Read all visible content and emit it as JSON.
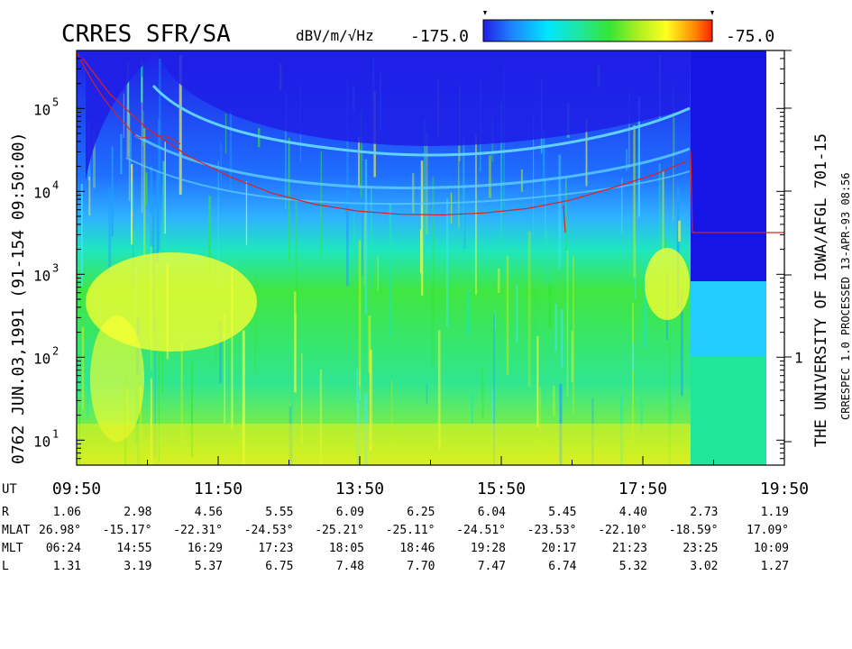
{
  "chart_data": {
    "type": "heatmap",
    "title": "CRRES SFR/SA",
    "colorbar": {
      "label": "dBV/m/√Hz",
      "min": -175.0,
      "max": -75.0,
      "min_label": "-175.0",
      "max_label": "-75.0",
      "colors": [
        "#1f1fe6",
        "#1f7fff",
        "#00e6ff",
        "#1fe6a0",
        "#33e633",
        "#b0f020",
        "#ffff20",
        "#ff8c00",
        "#ff2000"
      ]
    },
    "left_label": "0762   JUN.03,1991   (91-154 09:50:00)",
    "y_axis": {
      "scale": "log",
      "range": [
        5,
        500000
      ],
      "tick_labels": [
        {
          "value": 10,
          "label": "10",
          "exp": "1"
        },
        {
          "value": 100,
          "label": "10",
          "exp": "2"
        },
        {
          "value": 1000,
          "label": "10",
          "exp": "3"
        },
        {
          "value": 10000,
          "label": "10",
          "exp": "4"
        },
        {
          "value": 100000,
          "label": "10",
          "exp": "5"
        }
      ]
    },
    "right_axis": {
      "tick_labels": [
        {
          "value": 100,
          "label": "1"
        }
      ]
    },
    "x_axis": {
      "label": "UT",
      "range_hours": [
        9.833,
        19.833
      ],
      "tick_labels": [
        "09:50",
        "11:50",
        "13:50",
        "15:50",
        "17:50",
        "19:50"
      ]
    },
    "ephemeris": [
      {
        "label": "R",
        "values": [
          "1.06",
          "2.98",
          "4.56",
          "5.55",
          "6.09",
          "6.25",
          "6.04",
          "5.45",
          "4.40",
          "2.73",
          "1.19"
        ]
      },
      {
        "label": "MLAT",
        "values": [
          "26.98°",
          "-15.17°",
          "-22.31°",
          "-24.53°",
          "-25.21°",
          "-25.11°",
          "-24.51°",
          "-23.53°",
          "-22.10°",
          "-18.59°",
          "17.09°"
        ]
      },
      {
        "label": "MLT",
        "values": [
          "06:24",
          "14:55",
          "16:29",
          "17:23",
          "18:05",
          "18:46",
          "19:28",
          "20:17",
          "21:23",
          "23:25",
          "10:09"
        ]
      },
      {
        "label": "L",
        "values": [
          "1.31",
          "3.19",
          "5.37",
          "6.75",
          "7.48",
          "7.70",
          "7.47",
          "6.74",
          "5.32",
          "3.02",
          "1.27"
        ]
      }
    ],
    "right_label": "THE UNIVERSITY OF IOWA/AFGL  701-15",
    "right_label2": "CRRESPEC 1.0   PROCESSED 13-APR-93   08:56",
    "gyro_line": [
      [
        9.92,
        400000
      ],
      [
        10.3,
        150000
      ],
      [
        10.8,
        60000
      ],
      [
        11.4,
        27000
      ],
      [
        12.0,
        15000
      ],
      [
        12.6,
        9500
      ],
      [
        13.2,
        7000
      ],
      [
        13.8,
        5800
      ],
      [
        14.4,
        5300
      ],
      [
        15.0,
        5200
      ],
      [
        15.6,
        5500
      ],
      [
        16.2,
        6200
      ],
      [
        16.8,
        7800
      ],
      [
        17.4,
        11000
      ],
      [
        18.0,
        16000
      ],
      [
        18.45,
        23000
      ]
    ]
  }
}
